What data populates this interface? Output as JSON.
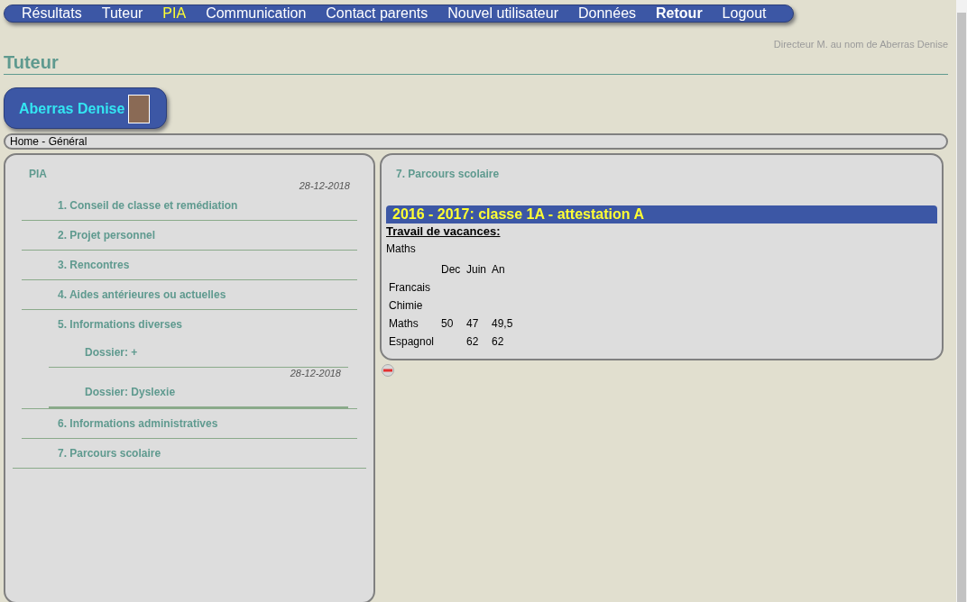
{
  "nav": [
    {
      "label": "Résultats",
      "selected": false,
      "bold": false
    },
    {
      "label": "Tuteur",
      "selected": false,
      "bold": false
    },
    {
      "label": "PIA",
      "selected": true,
      "bold": false
    },
    {
      "label": "Communication",
      "selected": false,
      "bold": false
    },
    {
      "label": "Contact parents",
      "selected": false,
      "bold": false
    },
    {
      "label": "Nouvel utilisateur",
      "selected": false,
      "bold": false
    },
    {
      "label": "Données",
      "selected": false,
      "bold": false
    },
    {
      "label": "Retour",
      "selected": false,
      "bold": true
    },
    {
      "label": "Logout",
      "selected": false,
      "bold": false
    }
  ],
  "user_note": "Directeur M. au nom de Aberras Denise",
  "page_title": "Tuteur",
  "student": {
    "name": "Aberras Denise"
  },
  "breadcrumb": "Home - Général",
  "pia": {
    "title": "PIA",
    "items": [
      {
        "label": "1. Conseil de classe et remédiation",
        "date": "28-12-2018"
      },
      {
        "label": "2. Projet personnel"
      },
      {
        "label": "3. Rencontres"
      },
      {
        "label": "4. Aides antérieures ou actuelles"
      },
      {
        "label": "5. Informations diverses",
        "children": [
          {
            "label": "Dossier: +"
          },
          {
            "label": "Dossier: Dyslexie",
            "date": "28-12-2018"
          }
        ]
      },
      {
        "label": "6. Informations administratives"
      },
      {
        "label": "7. Parcours scolaire"
      }
    ]
  },
  "detail": {
    "title": "7. Parcours scolaire",
    "year_header": "2016 - 2017: classe 1A - attestation A",
    "vacation_heading": "Travail de vacances:",
    "vacation_subject": "Maths",
    "grades": {
      "columns": [
        "Dec",
        "Juin",
        "An"
      ],
      "rows": [
        {
          "subject": "Francais",
          "cells": [
            null,
            null,
            null
          ]
        },
        {
          "subject": "Chimie",
          "cells": [
            null,
            null,
            null
          ]
        },
        {
          "subject": "Maths",
          "cells": [
            "50",
            "47",
            "49,5"
          ]
        },
        {
          "subject": "Espagnol",
          "cells": [
            null,
            "62",
            "62"
          ]
        }
      ]
    }
  }
}
